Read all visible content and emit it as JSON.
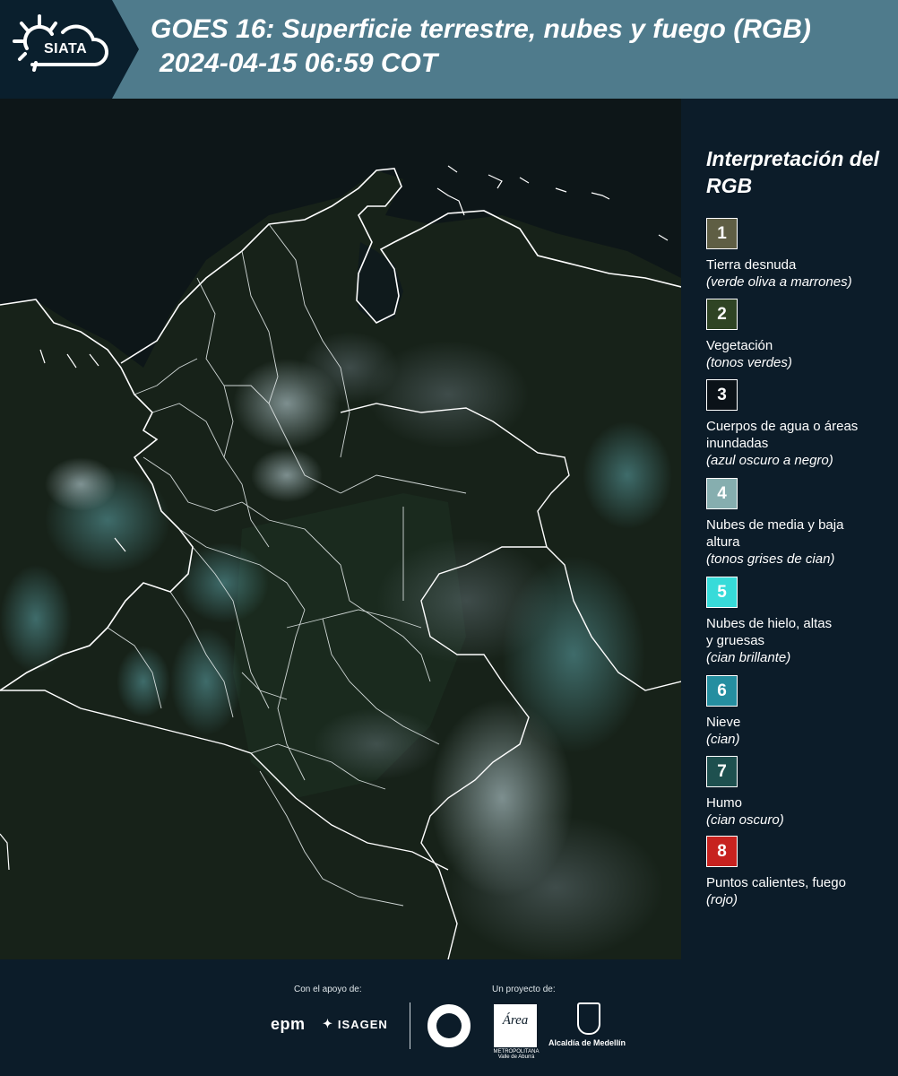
{
  "header": {
    "logo_text": "SIATA",
    "title_line1": "GOES 16: Superficie terrestre, nubes y fuego (RGB)",
    "title_line2": "2024-04-15 06:59 COT"
  },
  "legend": {
    "title": "Interpretación del RGB",
    "items": [
      {
        "num": "1",
        "color": "#5f5e44",
        "label": "Tierra desnuda",
        "sub": "(verde oliva a marrones)"
      },
      {
        "num": "2",
        "color": "#2f4424",
        "label": "Vegetación",
        "sub": "(tonos verdes)"
      },
      {
        "num": "3",
        "color": "#0b1218",
        "label": "Cuerpos de agua o áreas inundadas",
        "sub": "(azul oscuro a negro)"
      },
      {
        "num": "4",
        "color": "#86aeaf",
        "label": "Nubes de media y baja altura",
        "sub": "(tonos grises de cian)"
      },
      {
        "num": "5",
        "color": "#37dbd9",
        "label": "Nubes de hielo, altas y gruesas",
        "sub": "(cian brillante)"
      },
      {
        "num": "6",
        "color": "#258ea0",
        "label": "Nieve",
        "sub": "(cian)"
      },
      {
        "num": "7",
        "color": "#1e504f",
        "label": "Humo",
        "sub": "(cian oscuro)"
      },
      {
        "num": "8",
        "color": "#c7221f",
        "label": "Puntos calientes, fuego",
        "sub": "(rojo)"
      }
    ]
  },
  "footer": {
    "support_caption": "Con el apoyo de:",
    "project_caption": "Un proyecto de:",
    "epm": "epm",
    "isagen": "ISAGEN",
    "area_logo": "Área",
    "area_sub": "METROPOLITANA Valle de Aburrá",
    "medellin": "Alcaldía de Medellín"
  }
}
